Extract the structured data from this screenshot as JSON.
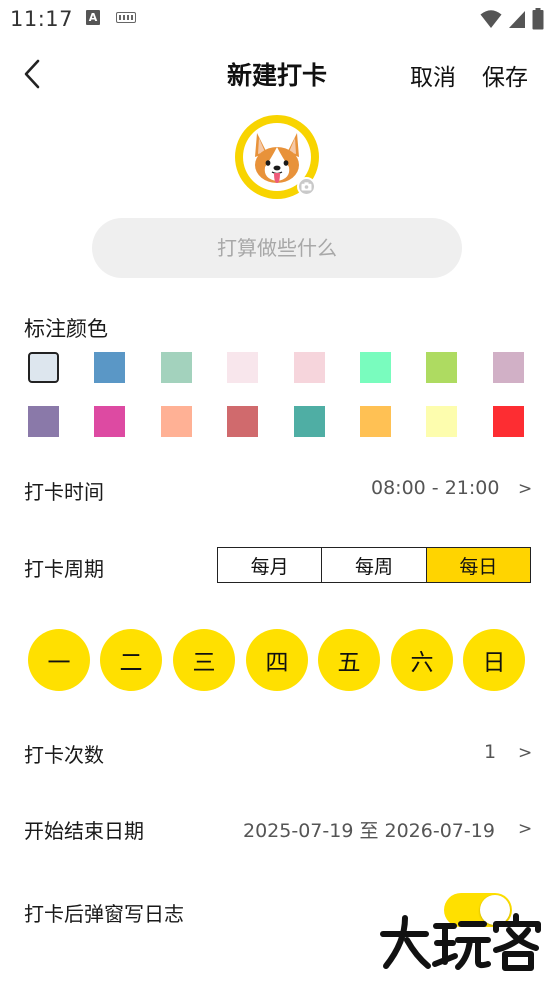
{
  "status_bar": {
    "time": "11:17",
    "notification_letter": "A",
    "icons": [
      "text-notification-icon",
      "keyboard-icon",
      "wifi-icon",
      "signal-icon",
      "battery-icon"
    ]
  },
  "header": {
    "title": "新建打卡",
    "cancel_label": "取消",
    "save_label": "保存"
  },
  "avatar": {
    "icon": "corgi-dog-icon",
    "badge_icon": "camera-icon"
  },
  "name_input": {
    "value": "",
    "placeholder": "打算做些什么"
  },
  "colors": {
    "label": "标注颜色",
    "selected_index": 0,
    "swatches": [
      "#dde6ee",
      "#5a97c6",
      "#a3d2bd",
      "#f8e6ec",
      "#f6d5dc",
      "#79fcbe",
      "#aedb61",
      "#d1b0c6",
      "#8a79a9",
      "#dd4aa2",
      "#ffb195",
      "#d06a6d",
      "#4faea4",
      "#ffc154",
      "#fdfdae",
      "#fd2d32"
    ]
  },
  "time_row": {
    "label": "打卡时间",
    "value": "08:00 - 21:00",
    "chevron": ">"
  },
  "period_row": {
    "label": "打卡周期",
    "options": [
      "每月",
      "每周",
      "每日"
    ],
    "selected": "每日"
  },
  "weekdays": [
    "一",
    "二",
    "三",
    "四",
    "五",
    "六",
    "日"
  ],
  "count_row": {
    "label": "打卡次数",
    "value": "1",
    "chevron": ">"
  },
  "date_row": {
    "label": "开始结束日期",
    "value": "2025-07-19 至 2026-07-19",
    "chevron": ">"
  },
  "journal_row": {
    "label": "打卡后弹窗写日志",
    "enabled": true
  },
  "watermark": {
    "text": "大玩客"
  },
  "theme": {
    "accent": "#ffe000",
    "avatar_ring": "#f8d400"
  }
}
